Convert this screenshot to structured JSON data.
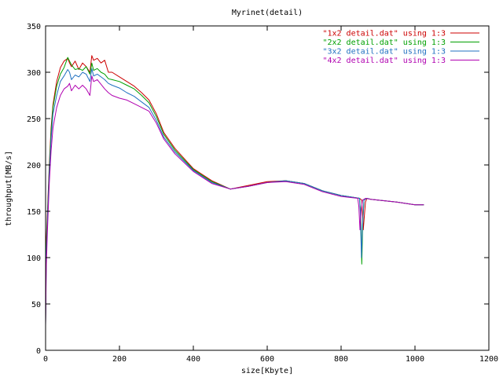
{
  "chart_data": {
    "type": "line",
    "title": "Myrinet(detail)",
    "xlabel": "size[Kbyte]",
    "ylabel": "throughput[MB/s]",
    "xlim": [
      0,
      1200
    ],
    "ylim": [
      0,
      350
    ],
    "xticks": [
      "0",
      "200",
      "400",
      "600",
      "800",
      "1000",
      "1200"
    ],
    "yticks": [
      "0",
      "50",
      "100",
      "150",
      "200",
      "250",
      "300",
      "350"
    ],
    "grid": false,
    "legend_position": "top-right",
    "series": [
      {
        "name": "\"1x2 detail.dat\" using 1:3",
        "color": "#cc0000",
        "x": [
          0,
          2,
          5,
          10,
          15,
          20,
          30,
          40,
          50,
          60,
          65,
          70,
          80,
          90,
          100,
          110,
          120,
          125,
          130,
          140,
          150,
          160,
          170,
          180,
          200,
          220,
          240,
          260,
          280,
          300,
          320,
          350,
          400,
          450,
          500,
          550,
          600,
          650,
          700,
          750,
          800,
          850,
          856,
          860,
          866,
          870,
          880,
          900,
          950,
          1000,
          1024
        ],
        "y": [
          30,
          120,
          150,
          200,
          240,
          265,
          290,
          305,
          312,
          315,
          310,
          306,
          312,
          303,
          310,
          306,
          300,
          318,
          313,
          315,
          310,
          313,
          300,
          300,
          295,
          290,
          285,
          278,
          270,
          255,
          235,
          218,
          196,
          183,
          174,
          178,
          182,
          183,
          180,
          172,
          167,
          164,
          162,
          130,
          160,
          164,
          163,
          162,
          160,
          157,
          157
        ]
      },
      {
        "name": "\"2x2 detail.dat\" using 1:3",
        "color": "#00a000",
        "x": [
          0,
          2,
          5,
          10,
          15,
          20,
          30,
          40,
          50,
          60,
          65,
          70,
          80,
          90,
          100,
          110,
          120,
          125,
          130,
          140,
          150,
          160,
          170,
          180,
          200,
          220,
          240,
          260,
          280,
          300,
          320,
          350,
          400,
          450,
          500,
          550,
          600,
          650,
          700,
          750,
          800,
          850,
          853,
          856,
          859,
          862,
          870,
          880,
          900,
          950,
          1000,
          1024
        ],
        "y": [
          28,
          110,
          145,
          195,
          235,
          262,
          285,
          298,
          305,
          316,
          312,
          308,
          303,
          304,
          302,
          306,
          298,
          310,
          302,
          304,
          300,
          298,
          293,
          292,
          290,
          286,
          282,
          275,
          267,
          252,
          233,
          216,
          195,
          182,
          174,
          177,
          181,
          183,
          180,
          172,
          167,
          164,
          150,
          93,
          140,
          162,
          164,
          163,
          162,
          160,
          157,
          157
        ]
      },
      {
        "name": "\"3x2 detail.dat\" using 1:3",
        "color": "#2070c0",
        "x": [
          0,
          2,
          5,
          10,
          15,
          20,
          30,
          40,
          50,
          60,
          65,
          70,
          80,
          90,
          100,
          110,
          120,
          125,
          130,
          140,
          150,
          160,
          170,
          180,
          200,
          220,
          240,
          260,
          280,
          300,
          320,
          350,
          400,
          450,
          500,
          550,
          600,
          650,
          700,
          750,
          800,
          850,
          852,
          855,
          858,
          862,
          870,
          880,
          900,
          950,
          1000,
          1024
        ],
        "y": [
          27,
          100,
          140,
          190,
          228,
          255,
          275,
          290,
          296,
          303,
          300,
          292,
          297,
          295,
          300,
          298,
          290,
          304,
          296,
          298,
          295,
          292,
          288,
          286,
          283,
          278,
          274,
          268,
          262,
          248,
          230,
          214,
          194,
          181,
          174,
          177,
          181,
          183,
          180,
          172,
          167,
          164,
          150,
          100,
          135,
          162,
          164,
          163,
          162,
          160,
          157,
          157
        ]
      },
      {
        "name": "\"4x2 detail.dat\" using 1:3",
        "color": "#b000b0",
        "x": [
          0,
          2,
          5,
          10,
          15,
          20,
          30,
          40,
          50,
          60,
          65,
          70,
          80,
          90,
          100,
          110,
          120,
          125,
          130,
          140,
          150,
          160,
          170,
          180,
          200,
          220,
          240,
          260,
          280,
          300,
          320,
          350,
          400,
          450,
          500,
          550,
          600,
          650,
          700,
          750,
          800,
          845,
          848,
          851,
          854,
          858,
          866,
          880,
          900,
          950,
          1000,
          1024
        ],
        "y": [
          26,
          90,
          130,
          180,
          215,
          240,
          262,
          275,
          282,
          285,
          288,
          280,
          286,
          282,
          286,
          282,
          275,
          296,
          290,
          292,
          287,
          282,
          278,
          275,
          272,
          270,
          266,
          262,
          258,
          245,
          228,
          212,
          193,
          180,
          174,
          177,
          181,
          182,
          179,
          171,
          166,
          164,
          155,
          130,
          150,
          162,
          164,
          163,
          162,
          160,
          157,
          157
        ]
      }
    ]
  }
}
